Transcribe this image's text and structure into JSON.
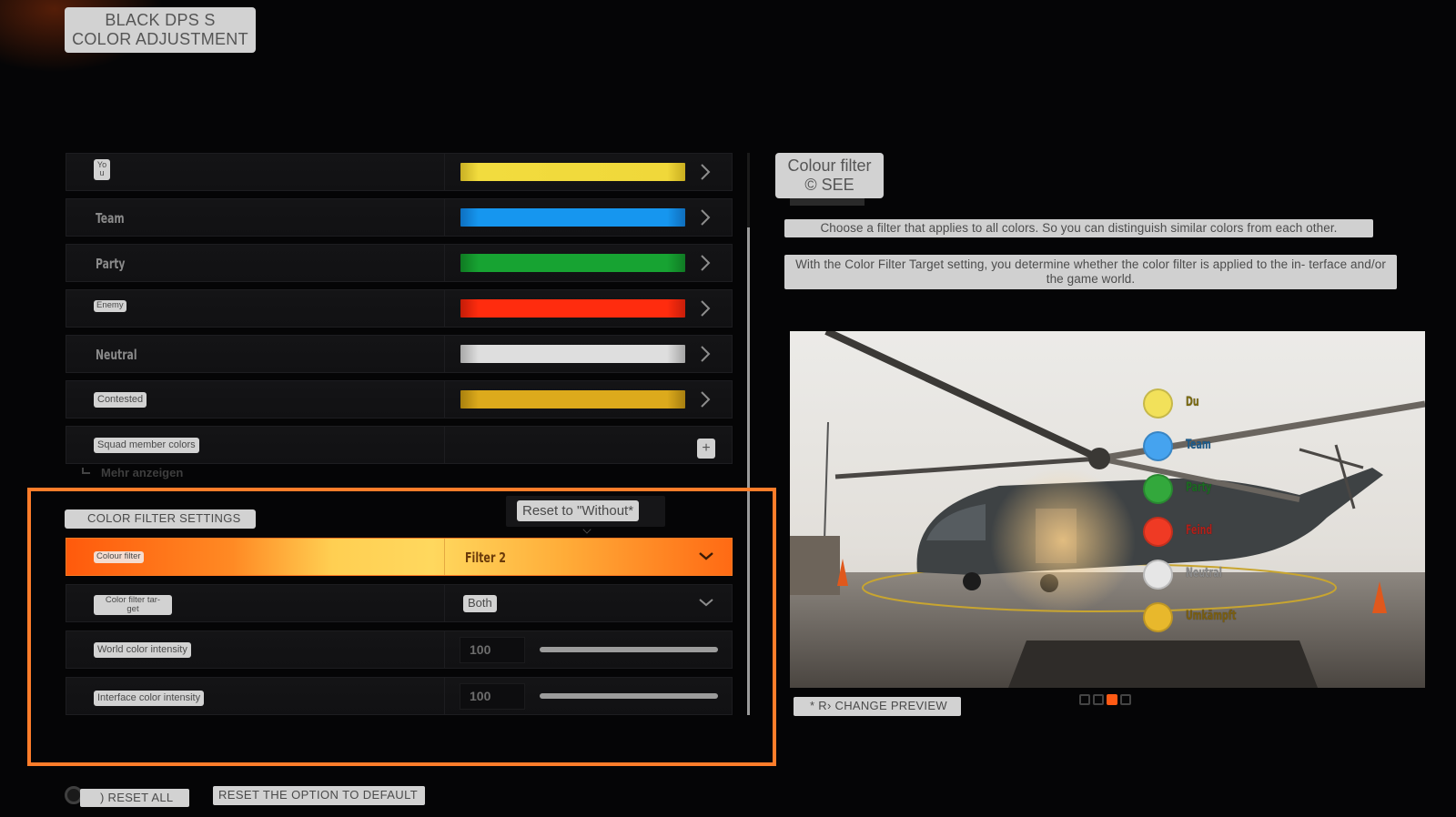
{
  "header": {
    "title_line1": "BLACK DPS S",
    "title_line2": "COLOR ADJUSTMENT"
  },
  "color_rows": [
    {
      "label": "Yo u",
      "label_style": "chip",
      "swatch": "#f0d83a",
      "icon": "chevron-right-icon"
    },
    {
      "label": "Team",
      "label_style": "plain",
      "swatch": "#1696ef",
      "icon": "chevron-right-icon"
    },
    {
      "label": "Party",
      "label_style": "plain",
      "swatch": "#17a332",
      "icon": "chevron-right-icon"
    },
    {
      "label": "Enemy",
      "label_style": "chip",
      "swatch": "#ff2c0e",
      "icon": "chevron-right-icon"
    },
    {
      "label": "Neutral",
      "label_style": "plain",
      "swatch": "#dedede",
      "icon": "chevron-right-icon"
    },
    {
      "label": "Contested",
      "label_style": "chip",
      "swatch": "#dcaa1c",
      "icon": "chevron-right-icon"
    },
    {
      "label": "Squad member colors",
      "label_style": "chip",
      "icon": "plus-icon",
      "action": "+"
    }
  ],
  "more_link": "Mehr anzeigen",
  "color_filter_section": {
    "title": "COLOR FILTER SETTINGS",
    "tooltip": "Reset to \"Without*",
    "rows": [
      {
        "label": "Colour filter",
        "value": "Filter 2",
        "type": "dropdown",
        "active": true
      },
      {
        "label": "Color filter tar- get",
        "value": "Both",
        "type": "dropdown",
        "active": false
      },
      {
        "label": "World color intensity",
        "value": "100",
        "type": "slider",
        "fraction": 1.0
      },
      {
        "label": "Interface color intensity",
        "value": "100",
        "type": "slider",
        "fraction": 1.0
      }
    ]
  },
  "info_panel": {
    "title_line1": "Colour filter",
    "title_line2": "© SEE",
    "description_1": "Choose a filter that applies to all colors. So you can distinguish similar colors from each other.",
    "description_2": "With the Color Filter Target setting, you determine whether the color filter is applied to the in- terface and/or the game world."
  },
  "preview": {
    "legend": [
      {
        "label": "Du",
        "color": "#f2e15a",
        "text_color": "#7a6a10"
      },
      {
        "label": "Team",
        "color": "#45a3ef",
        "text_color": "#1c5c8c"
      },
      {
        "label": "Party",
        "color": "#33a83c",
        "text_color": "#1c6a22"
      },
      {
        "label": "Feind",
        "color": "#ef3a24",
        "text_color": "#b0201a"
      },
      {
        "label": "Neutral",
        "color": "#e6e6e6",
        "text_color": "#8a8a8a"
      },
      {
        "label": "Umkämpft",
        "color": "#e8b82c",
        "text_color": "#7a5e10"
      }
    ],
    "change_preview_label": "* R› CHANGE PREVIEW",
    "pages_total": 4,
    "page_active": 3
  },
  "footer": {
    "reset_all": ") RESET ALL",
    "reset_default": "RESET THE OPTION TO DEFAULT"
  },
  "colors": {
    "accent": "#ff7d2a"
  }
}
